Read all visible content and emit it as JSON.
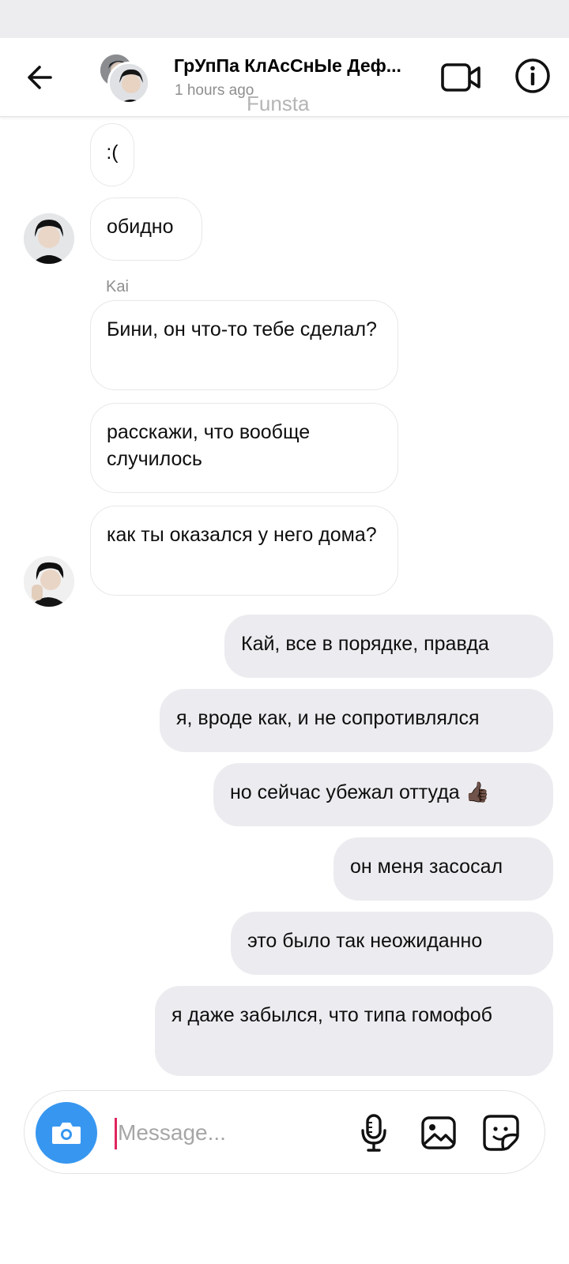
{
  "header": {
    "title": "ГрУпПа КлАсСнЫе Деф...",
    "subtitle": "1 hours ago"
  },
  "watermark": "Funsta",
  "messages": [
    {
      "text": ":(",
      "direction": "in"
    },
    {
      "text": "обидно",
      "direction": "in"
    },
    {
      "sender": "Kai"
    },
    {
      "text": "Бини, он что-то тебе сделал?",
      "direction": "in"
    },
    {
      "text": "расскажи, что вообще случилось",
      "direction": "in"
    },
    {
      "text": "как ты оказался у него дома?",
      "direction": "in"
    },
    {
      "text": "Кай, все в порядке, правда",
      "direction": "out"
    },
    {
      "text": "я, вроде как, и не сопротивлялся",
      "direction": "out"
    },
    {
      "text": "но сейчас убежал оттуда 👍🏿",
      "direction": "out"
    },
    {
      "text": "он меня засосал",
      "direction": "out"
    },
    {
      "text": "это было так неожиданно",
      "direction": "out"
    },
    {
      "text": "я даже забылся, что типа гомофоб",
      "direction": "out"
    }
  ],
  "composer": {
    "placeholder": "Message..."
  },
  "icons": {
    "back": "arrow-left-icon",
    "video": "video-camera-icon",
    "info": "info-icon",
    "camera": "camera-icon",
    "mic": "microphone-icon",
    "gallery": "image-icon",
    "sticker": "sticker-icon"
  },
  "colors": {
    "accent": "#3797f0",
    "outgoing_bubble": "#ececf0",
    "secondary_text": "#8e8e8e"
  }
}
